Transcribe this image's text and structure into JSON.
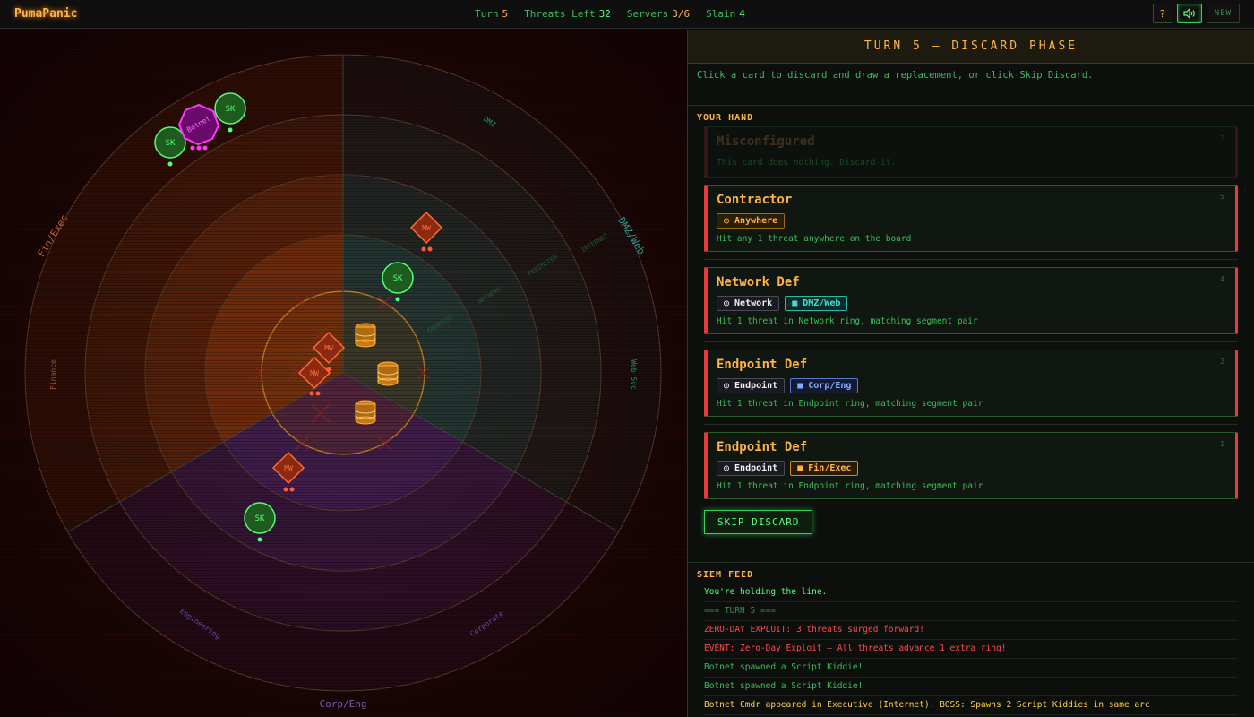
{
  "app": {
    "title": "PumaPanic"
  },
  "stats": [
    {
      "label": "Turn",
      "value": "5",
      "color": "#ffb347"
    },
    {
      "label": "Threats Left",
      "value": "32",
      "color": "#56ff7a"
    },
    {
      "label": "Servers",
      "value": "3/6",
      "color": "#ffb347"
    },
    {
      "label": "Slain",
      "value": "4",
      "color": "#56ff7a"
    }
  ],
  "top_buttons": {
    "help": "?",
    "sound_icon": "speaker-icon",
    "new": "NEW"
  },
  "board": {
    "segments": [
      {
        "name": "Fin/Exec",
        "color": "#ff7a1a"
      },
      {
        "name": "DMZ/Web",
        "color": "#2ab8aa"
      },
      {
        "name": "Corp/Eng",
        "color": "#7a4ad8"
      }
    ],
    "sub_segments": [
      "Finance",
      "DMZ",
      "Web Svc",
      "Corporate",
      "Engineering"
    ],
    "ring_labels": [
      "INTERNET",
      "PERIMETER",
      "NETWORK",
      "ENDPOINT"
    ],
    "threat_badges": [
      "SK",
      "SK",
      "SK",
      "SK",
      "MW",
      "MW",
      "MW",
      "MW"
    ],
    "boss_label": "Botnet"
  },
  "panel": {
    "phase_title": "TURN 5 — DISCARD PHASE",
    "instructions": "Click a card to discard and draw a replacement, or click Skip Discard.",
    "hand_title": "YOUR HAND",
    "cards": [
      {
        "title": "Misconfigured",
        "num": "7",
        "desc": "This card does nothing. Discard it.",
        "tags": []
      },
      {
        "title": "Contractor",
        "num": "5",
        "desc": "Hit any 1 threat anywhere on the board",
        "tags": [
          {
            "label": "◎ Anywhere",
            "kind": "anywhere"
          }
        ]
      },
      {
        "title": "Network Def",
        "num": "4",
        "desc": "Hit 1 threat in Network ring, matching segment pair",
        "tags": [
          {
            "label": "◎ Network",
            "kind": "ring"
          },
          {
            "label": "■ DMZ/Web",
            "kind": "dmz"
          }
        ]
      },
      {
        "title": "Endpoint Def",
        "num": "2",
        "desc": "Hit 1 threat in Endpoint ring, matching segment pair",
        "tags": [
          {
            "label": "◎ Endpoint",
            "kind": "ring"
          },
          {
            "label": "■ Corp/Eng",
            "kind": "corp"
          }
        ]
      },
      {
        "title": "Endpoint Def",
        "num": "1",
        "desc": "Hit 1 threat in Endpoint ring, matching segment pair",
        "tags": [
          {
            "label": "◎ Endpoint",
            "kind": "ring"
          },
          {
            "label": "■ Fin/Exec",
            "kind": "fin"
          }
        ]
      }
    ],
    "skip_label": "SKIP DISCARD",
    "siem_title": "SIEM FEED",
    "feed": [
      {
        "text": "You're holding the line.",
        "kind": "fi-green"
      },
      {
        "text": "=== TURN 5 ===",
        "kind": "fi-dim"
      },
      {
        "text": "ZERO-DAY EXPLOIT: 3 threats surged forward!",
        "kind": "fi-red"
      },
      {
        "text": "EVENT: Zero-Day Exploit — All threats advance 1 extra ring!",
        "kind": "fi-red"
      },
      {
        "text": "Botnet spawned a Script Kiddie!",
        "kind": "fi-dgreen"
      },
      {
        "text": "Botnet spawned a Script Kiddie!",
        "kind": "fi-dgreen"
      },
      {
        "text": "Botnet Cmdr appeared in Executive (Internet). BOSS: Spawns 2 Script Kiddies in same arc",
        "kind": "fi-yellow"
      }
    ]
  }
}
